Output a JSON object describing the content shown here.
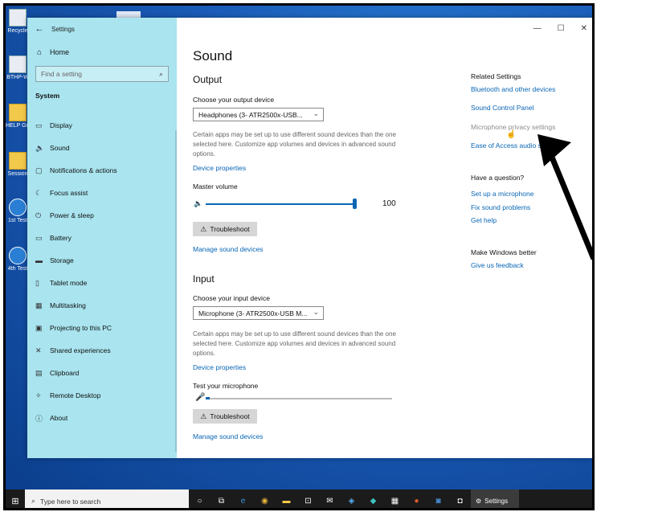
{
  "desktop": {
    "icons": [
      {
        "label": "Recycle",
        "kind": "bin"
      },
      {
        "label": "BTHP-W",
        "kind": "doc"
      },
      {
        "label": "HELP Gimbal",
        "kind": "folder"
      },
      {
        "label": "Session",
        "kind": "folder"
      },
      {
        "label": "1st Test",
        "kind": "blue"
      },
      {
        "label": "4th Test",
        "kind": "blue"
      }
    ]
  },
  "window": {
    "app_title": "Settings",
    "controls": {
      "minimize": "—",
      "maximize": "☐",
      "close": "✕"
    }
  },
  "sidebar": {
    "home_label": "Home",
    "search_placeholder": "Find a setting",
    "section": "System",
    "items": [
      {
        "label": "Display",
        "icon": "display-icon",
        "glyph": "▭"
      },
      {
        "label": "Sound",
        "icon": "speaker-icon",
        "glyph": "🔈"
      },
      {
        "label": "Notifications & actions",
        "icon": "notifications-icon",
        "glyph": "▢"
      },
      {
        "label": "Focus assist",
        "icon": "moon-icon",
        "glyph": "☾"
      },
      {
        "label": "Power & sleep",
        "icon": "power-icon",
        "glyph": "⏻"
      },
      {
        "label": "Battery",
        "icon": "battery-icon",
        "glyph": "▭"
      },
      {
        "label": "Storage",
        "icon": "storage-icon",
        "glyph": "▬"
      },
      {
        "label": "Tablet mode",
        "icon": "tablet-icon",
        "glyph": "▯"
      },
      {
        "label": "Multitasking",
        "icon": "multitasking-icon",
        "glyph": "▦"
      },
      {
        "label": "Projecting to this PC",
        "icon": "projector-icon",
        "glyph": "▣"
      },
      {
        "label": "Shared experiences",
        "icon": "shared-icon",
        "glyph": "✕"
      },
      {
        "label": "Clipboard",
        "icon": "clipboard-icon",
        "glyph": "▤"
      },
      {
        "label": "Remote Desktop",
        "icon": "remote-icon",
        "glyph": "✧"
      },
      {
        "label": "About",
        "icon": "info-icon",
        "glyph": "ⓘ"
      }
    ]
  },
  "main": {
    "title": "Sound",
    "output": {
      "heading": "Output",
      "choose_label": "Choose your output device",
      "device": "Headphones (3- ATR2500x-USB...",
      "description": "Certain apps may be set up to use different sound devices than the one selected here. Customize app volumes and devices in advanced sound options.",
      "device_properties": "Device properties",
      "master_volume_label": "Master volume",
      "volume_value": "100",
      "volume_level": 1.0,
      "troubleshoot": "Troubleshoot",
      "manage": "Manage sound devices"
    },
    "input": {
      "heading": "Input",
      "choose_label": "Choose your input device",
      "device": "Microphone (3- ATR2500x-USB M...",
      "description": "Certain apps may be set up to use different sound devices than the one selected here. Customize app volumes and devices in advanced sound options.",
      "device_properties": "Device properties",
      "test_label": "Test your microphone",
      "mic_level": 0.02,
      "troubleshoot": "Troubleshoot",
      "manage": "Manage sound devices"
    }
  },
  "related": {
    "heading": "Related Settings",
    "links": [
      "Bluetooth and other devices",
      "Sound Control Panel",
      "Microphone privacy settings",
      "Ease of Access audio se"
    ],
    "question_heading": "Have a question?",
    "question_links": [
      "Set up a microphone",
      "Fix sound problems",
      "Get help"
    ],
    "better_heading": "Make Windows better",
    "feedback": "Give us feedback"
  },
  "taskbar": {
    "search_text": "Type here to search",
    "active_app": "Settings"
  },
  "colors": {
    "accent": "#0a66b5",
    "sidebar": "#a9e4ef",
    "taskbar": "#1b1b1b"
  }
}
